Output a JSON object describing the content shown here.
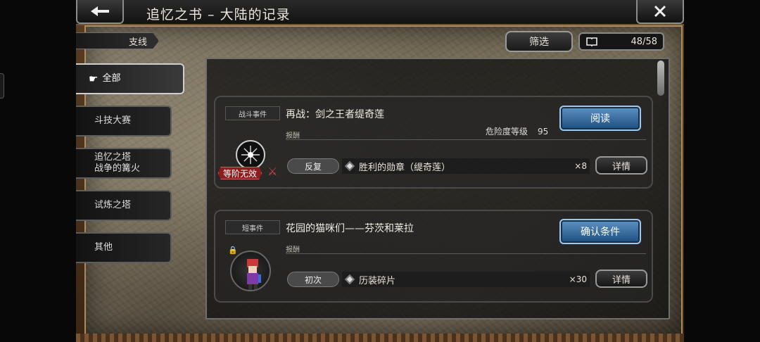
{
  "header": {
    "title": "追忆之书 – 大陆的记录",
    "back_icon": "arrow-left-icon",
    "close_icon": "close-icon"
  },
  "top_bar": {
    "branch_label": "支线",
    "filter_label": "筛选",
    "counter_value": "48/58",
    "counter_icon": "book-icon"
  },
  "nav": {
    "items": [
      {
        "label": "全部",
        "active": true
      },
      {
        "label": "斗技大赛"
      },
      {
        "label": "追忆之塔\n战争的篝火"
      },
      {
        "label": "试炼之塔"
      },
      {
        "label": "其他"
      }
    ]
  },
  "cards": [
    {
      "tag": "战斗事件",
      "name": "再战：剑之王者缇奇莲",
      "danger_label": "危险度等级",
      "danger_value": "95",
      "reward_label": "报酬",
      "action_label": "阅读",
      "reward_type": "反复",
      "reward_name": "胜利的勋章（缇奇莲）",
      "reward_count": "×8",
      "detail_label": "详情",
      "badge": "等阶无效"
    },
    {
      "tag": "短事件",
      "name": "花园的猫咪们——芬茨和莱拉",
      "reward_label": "报酬",
      "action_label": "确认条件",
      "reward_type": "初次",
      "reward_name": "历装碎片",
      "reward_count": "×30",
      "detail_label": "详情"
    }
  ],
  "colors": {
    "action_blue": "#2f6ea8",
    "badge_red": "#8f1d1d",
    "frame_brown": "#5a3e24"
  }
}
